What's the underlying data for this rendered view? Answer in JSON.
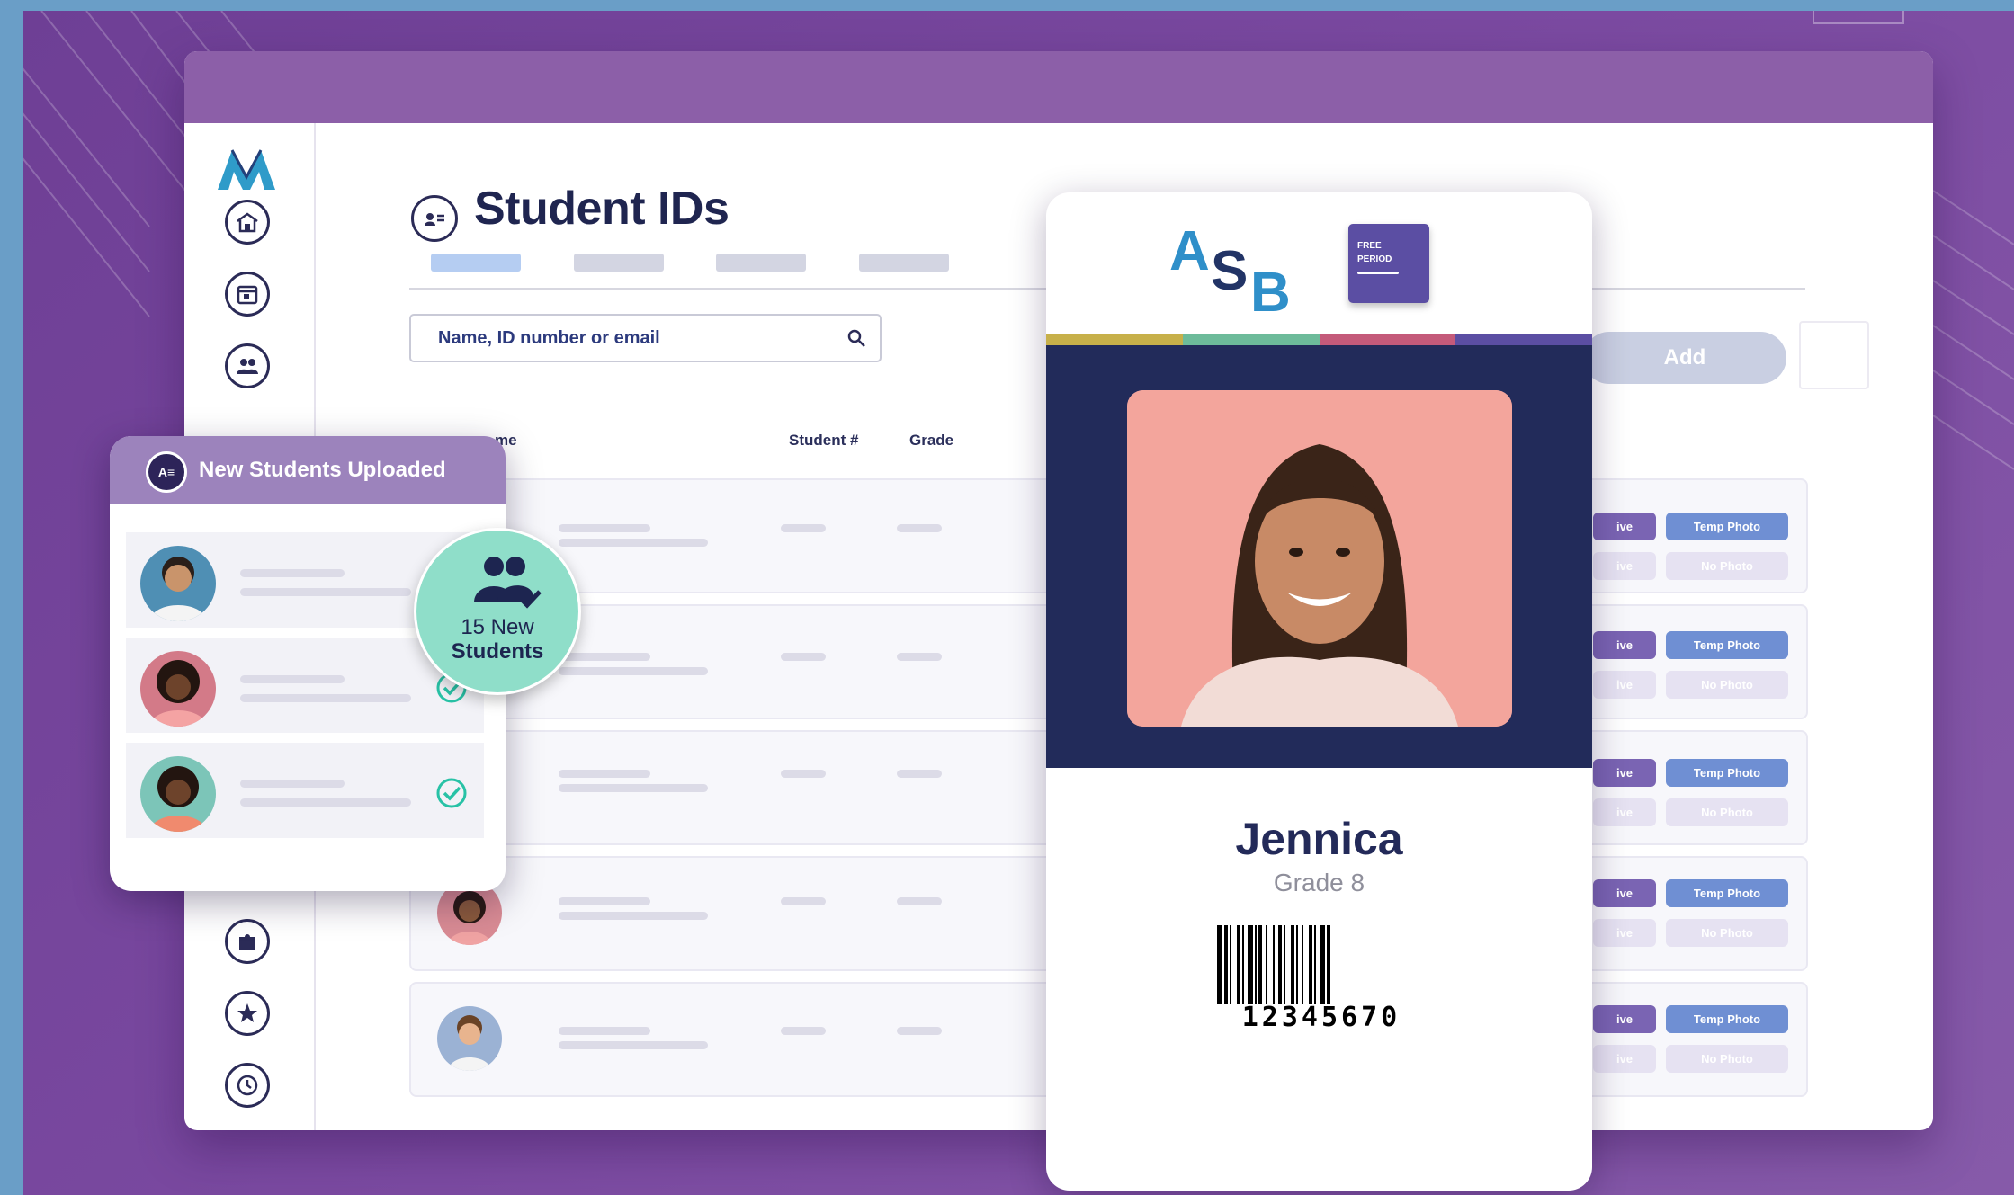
{
  "page": {
    "title": "Student IDs",
    "search_placeholder": "Name, ID number or email",
    "add_label": "Add",
    "columns": {
      "name_partial": "me",
      "student_number": "Student #",
      "grade": "Grade"
    }
  },
  "sidebar": {
    "icons": [
      "school-icon",
      "calendar-icon",
      "users-icon",
      "puzzle-icon",
      "star-icon",
      "clock-icon"
    ]
  },
  "rows": [
    {
      "status": "ive",
      "photo": "Temp Photo",
      "photo_alt": "No Photo"
    },
    {
      "status": "ive",
      "photo": "Temp Photo",
      "photo_alt": "No Photo"
    },
    {
      "status": "ive",
      "photo": "Temp Photo",
      "photo_alt": "No Photo"
    },
    {
      "status": "ive",
      "photo": "Temp Photo",
      "photo_alt": "No Photo"
    },
    {
      "status": "ive",
      "photo": "Temp Photo",
      "photo_alt": "No Photo"
    }
  ],
  "upload_panel": {
    "title": "New Students Uploaded",
    "icon_text": "A≡",
    "badge_line1": "15 New",
    "badge_line2": "Students"
  },
  "id_card": {
    "school_logo": "ASB",
    "tag_line1": "FREE",
    "tag_line2": "PERIOD",
    "name": "Jennica",
    "grade": "Grade 8",
    "barcode_number": "12345670"
  },
  "colors": {
    "background": "#7b4aa1",
    "topbar": "#8c5fa8",
    "navy": "#222b5a",
    "accent_teal": "#8fdec9",
    "chip_purple": "#7a64b3",
    "chip_blue": "#6f8fd3"
  }
}
